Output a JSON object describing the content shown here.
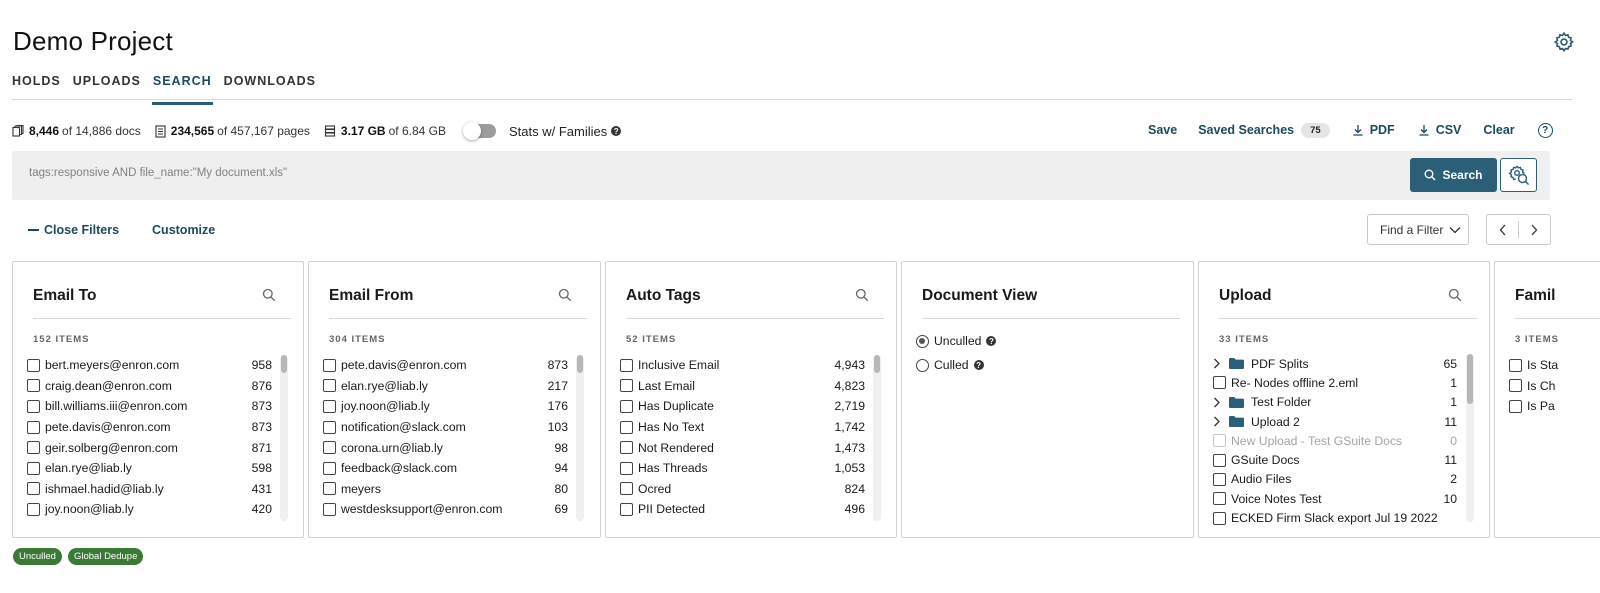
{
  "project": {
    "title": "Demo Project"
  },
  "tabs": [
    {
      "label": "HOLDS",
      "active": false
    },
    {
      "label": "UPLOADS",
      "active": false
    },
    {
      "label": "SEARCH",
      "active": true
    },
    {
      "label": "DOWNLOADS",
      "active": false
    }
  ],
  "stats": {
    "docs_bold": "8,446",
    "docs_rest": "of 14,886 docs",
    "pages_bold": "234,565",
    "pages_rest": "of 457,167 pages",
    "size_bold": "3.17 GB",
    "size_rest": "of 6.84 GB",
    "families_label": "Stats w/ Families",
    "families_on": false
  },
  "actions": {
    "save": "Save",
    "saved_searches": "Saved Searches",
    "saved_count": "75",
    "pdf": "PDF",
    "csv": "CSV",
    "clear": "Clear",
    "help": "?"
  },
  "search": {
    "placeholder": "tags:responsive AND file_name:\"My document.xls\"",
    "button": "Search"
  },
  "filters": {
    "close": "Close Filters",
    "customize": "Customize",
    "find": "Find a Filter"
  },
  "panels": {
    "email_to": {
      "title": "Email To",
      "count": "152 ITEMS",
      "items": [
        {
          "label": "bert.meyers@enron.com",
          "value": "958"
        },
        {
          "label": "craig.dean@enron.com",
          "value": "876"
        },
        {
          "label": "bill.williams.iii@enron.com",
          "value": "873"
        },
        {
          "label": "pete.davis@enron.com",
          "value": "873"
        },
        {
          "label": "geir.solberg@enron.com",
          "value": "871"
        },
        {
          "label": "elan.rye@liab.ly",
          "value": "598"
        },
        {
          "label": "ishmael.hadid@liab.ly",
          "value": "431"
        },
        {
          "label": "joy.noon@liab.ly",
          "value": "420"
        }
      ]
    },
    "email_from": {
      "title": "Email From",
      "count": "304 ITEMS",
      "items": [
        {
          "label": "pete.davis@enron.com",
          "value": "873"
        },
        {
          "label": "elan.rye@liab.ly",
          "value": "217"
        },
        {
          "label": "joy.noon@liab.ly",
          "value": "176"
        },
        {
          "label": "notification@slack.com",
          "value": "103"
        },
        {
          "label": "corona.urn@liab.ly",
          "value": "98"
        },
        {
          "label": "feedback@slack.com",
          "value": "94"
        },
        {
          "label": "meyers",
          "value": "80"
        },
        {
          "label": "westdesksupport@enron.com",
          "value": "69"
        }
      ]
    },
    "auto_tags": {
      "title": "Auto Tags",
      "count": "52 ITEMS",
      "items": [
        {
          "label": "Inclusive Email",
          "value": "4,943"
        },
        {
          "label": "Last Email",
          "value": "4,823"
        },
        {
          "label": "Has Duplicate",
          "value": "2,719"
        },
        {
          "label": "Has No Text",
          "value": "1,742"
        },
        {
          "label": "Not Rendered",
          "value": "1,473"
        },
        {
          "label": "Has Threads",
          "value": "1,053"
        },
        {
          "label": "Ocred",
          "value": "824"
        },
        {
          "label": "PII Detected",
          "value": "496"
        }
      ]
    },
    "document_view": {
      "title": "Document View",
      "options": [
        {
          "label": "Unculled",
          "selected": true
        },
        {
          "label": "Culled",
          "selected": false
        }
      ]
    },
    "upload": {
      "title": "Upload",
      "count": "33 ITEMS",
      "items": [
        {
          "label": "PDF Splits",
          "value": "65",
          "type": "folder"
        },
        {
          "label": "Re- Nodes offline 2.eml",
          "value": "1",
          "type": "file"
        },
        {
          "label": "Test Folder",
          "value": "1",
          "type": "folder"
        },
        {
          "label": "Upload 2",
          "value": "11",
          "type": "folder"
        },
        {
          "label": "New Upload - Test GSuite Docs",
          "value": "0",
          "type": "disabled"
        },
        {
          "label": "GSuite Docs",
          "value": "11",
          "type": "file"
        },
        {
          "label": "Audio Files",
          "value": "2",
          "type": "file"
        },
        {
          "label": "Voice Notes Test",
          "value": "10",
          "type": "file"
        },
        {
          "label": "ECKED Firm Slack export Jul 19 2022",
          "value": "",
          "type": "file"
        }
      ]
    },
    "family": {
      "title": "Famil",
      "count": "3 ITEMS",
      "items": [
        {
          "label": "Is Sta"
        },
        {
          "label": "Is Ch"
        },
        {
          "label": "Is Pa"
        }
      ]
    }
  },
  "chips": [
    "Unculled",
    "Global Dedupe"
  ],
  "colors": {
    "accent": "#2a5f77",
    "chip": "#3a7a35"
  }
}
